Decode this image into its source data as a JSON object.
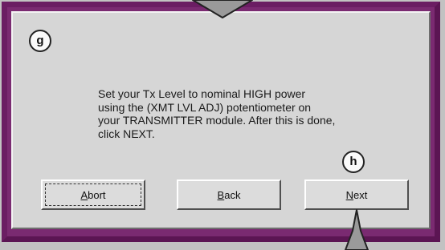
{
  "callouts": {
    "g": "g",
    "h": "h"
  },
  "message": {
    "lines": [
      "Set your Tx Level to nominal HIGH power",
      "using the (XMT LVL ADJ) potentiometer on",
      "your TRANSMITTER module. After this is done,",
      "click NEXT."
    ]
  },
  "buttons": {
    "abort": {
      "mnemonic": "A",
      "rest": "bort"
    },
    "back": {
      "mnemonic": "B",
      "rest": "ack"
    },
    "next": {
      "mnemonic": "N",
      "rest": "ext"
    }
  },
  "colors": {
    "frame": "#6b1d63",
    "panel": "#d6d6d6",
    "arrow": "#9a9a9a"
  },
  "icons": {
    "top": "pointer-arrow-down-icon",
    "bottom": "pointer-arrow-up-icon"
  }
}
